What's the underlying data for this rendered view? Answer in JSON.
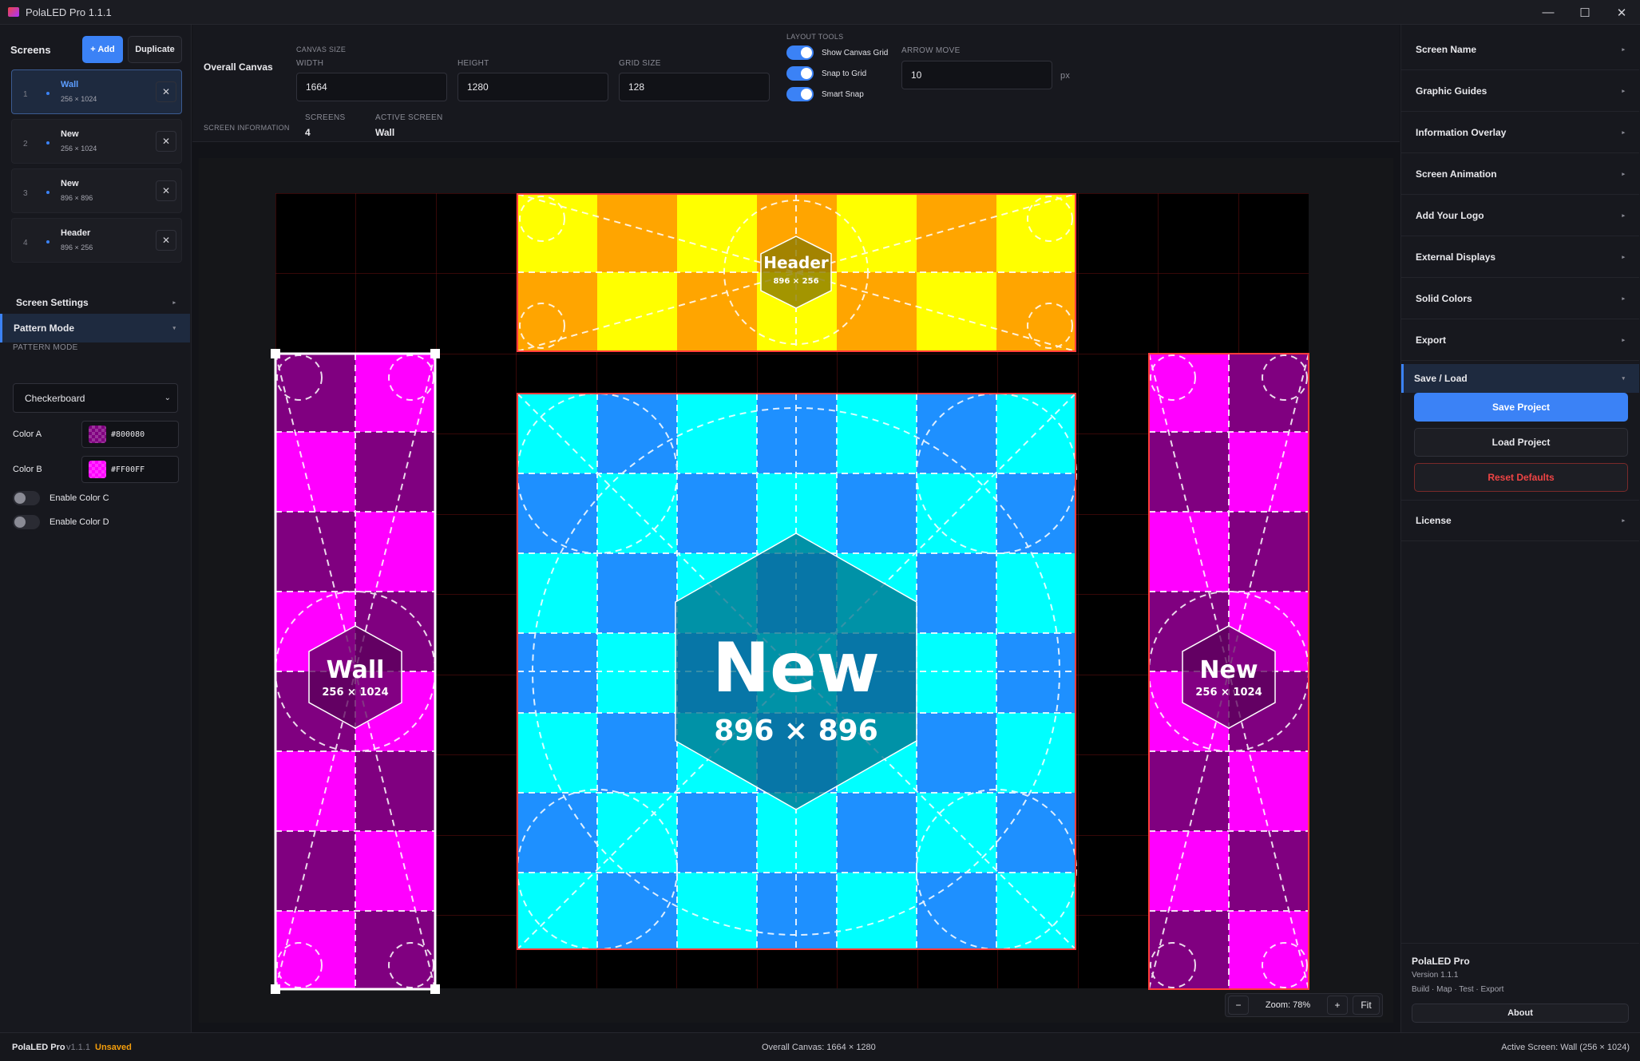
{
  "window": {
    "title": "PolaLED Pro 1.1.1",
    "controls": [
      "—",
      "☐",
      "✕"
    ]
  },
  "left": {
    "screens_label": "Screens",
    "add_label": "+ Add",
    "duplicate_label": "Duplicate",
    "screens": [
      {
        "index": "1",
        "name": "Wall",
        "size": "256 × 1024",
        "active": true
      },
      {
        "index": "2",
        "name": "New",
        "size": "256 × 1024",
        "active": false
      },
      {
        "index": "3",
        "name": "New",
        "size": "896 × 896",
        "active": false
      },
      {
        "index": "4",
        "name": "Header",
        "size": "896 × 256",
        "active": false
      }
    ],
    "screen_settings_label": "Screen Settings",
    "pattern_mode_section": "Pattern Mode",
    "pattern_mode_label": "PATTERN MODE",
    "pattern_mode_value": "Checkerboard",
    "color_a_label": "Color A",
    "color_a_value": "#800080",
    "color_b_label": "Color B",
    "color_b_value": "#FF00FF",
    "enable_c_label": "Enable Color C",
    "enable_d_label": "Enable Color D"
  },
  "topbar": {
    "overall_canvas_label": "Overall Canvas",
    "canvas_size_label": "CANVAS SIZE",
    "width_label": "WIDTH",
    "width_value": "1664",
    "height_label": "HEIGHT",
    "height_value": "1280",
    "grid_label": "GRID SIZE",
    "grid_value": "128",
    "layout_tools_label": "LAYOUT TOOLS",
    "show_grid_label": "Show Canvas Grid",
    "snap_grid_label": "Snap to Grid",
    "smart_snap_label": "Smart Snap",
    "arrow_move_label": "ARROW MOVE",
    "arrow_move_value": "10",
    "arrow_move_unit": "px",
    "screen_info_label": "SCREEN INFORMATION",
    "screens_count_label": "SCREENS",
    "screens_count_value": "4",
    "active_screen_label": "ACTIVE SCREEN",
    "active_screen_value": "Wall"
  },
  "canvas": {
    "screens": [
      {
        "name": "Wall",
        "size": "256 × 1024",
        "color_a": "#800080",
        "color_b": "#FF00FF"
      },
      {
        "name": "Header",
        "size": "896 × 256",
        "color_a": "#FFA500",
        "color_b": "#FFFF00"
      },
      {
        "name": "New",
        "size": "896 × 896",
        "color_a": "#1E90FF",
        "color_b": "#00FFFF"
      },
      {
        "name": "New",
        "size": "256 × 1024",
        "color_a": "#800080",
        "color_b": "#FF00FF"
      }
    ]
  },
  "zoom": {
    "minus": "−",
    "label": "Zoom: 78%",
    "plus": "+",
    "fit": "Fit"
  },
  "right": {
    "sections": [
      "Screen Name",
      "Graphic Guides",
      "Information Overlay",
      "Screen Animation",
      "Add Your Logo",
      "External Displays",
      "Solid Colors",
      "Export"
    ],
    "save_load_label": "Save / Load",
    "save_label": "Save Project",
    "load_label": "Load Project",
    "reset_label": "Reset Defaults",
    "license_label": "License",
    "app_name": "PolaLED Pro",
    "version": "Version 1.1.1",
    "tagline": "Build · Map · Test · Export",
    "about_label": "About"
  },
  "status": {
    "app_name": "PolaLED Pro",
    "version": "v1.1.1",
    "unsaved": "Unsaved",
    "center": "Overall Canvas: 1664 × 1280",
    "right": "Active Screen: Wall (256 × 1024)"
  },
  "colors": {
    "accent": "#3b82f6",
    "danger": "#ef4444",
    "warn": "#f59e0b"
  }
}
